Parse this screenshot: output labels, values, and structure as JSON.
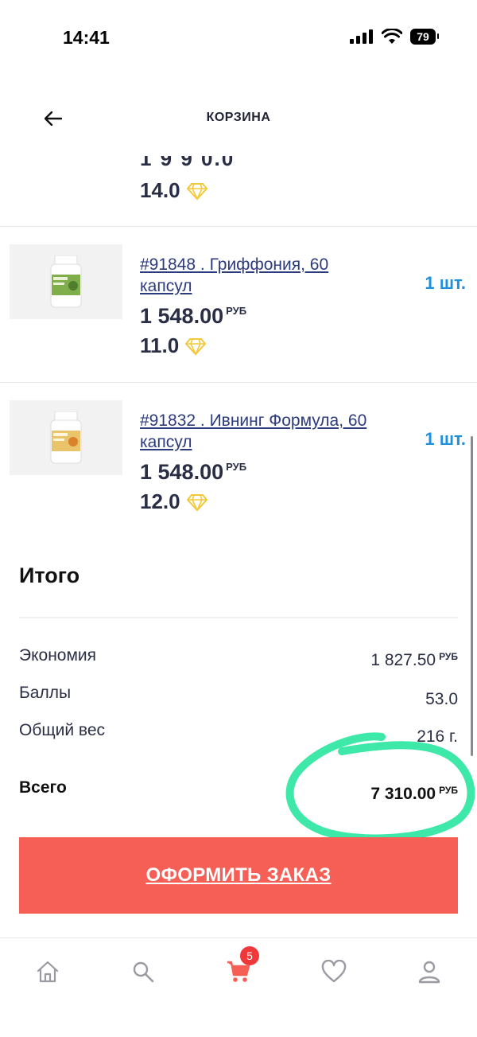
{
  "status_bar": {
    "time": "14:41",
    "battery": "79"
  },
  "header": {
    "title": "КОРЗИНА"
  },
  "partial_item": {
    "points": "14.0"
  },
  "items": [
    {
      "link": "#91848 . Гриффония, 60 капсул",
      "price": "1 548.00",
      "currency": "РУБ",
      "points": "11.0",
      "qty": "1 шт."
    },
    {
      "link": "#91832 . Ивнинг Формула, 60 капсул",
      "price": "1 548.00",
      "currency": "РУБ",
      "points": "12.0",
      "qty": "1 шт."
    }
  ],
  "summary": {
    "title": "Итого",
    "savings_label": "Экономия",
    "savings_value": "1 827.50",
    "savings_currency": "РУБ",
    "points_label": "Баллы",
    "points_value": "53.0",
    "weight_label": "Общий вес",
    "weight_value": "216 г.",
    "total_label": "Всего",
    "total_value": "7 310.00",
    "total_currency": "РУБ"
  },
  "order_button": {
    "label": "ОФОРМИТЬ ЗАКАЗ"
  },
  "tabbar": {
    "cart_count": "5"
  },
  "colors": {
    "accent": "#f65f55",
    "qty_blue": "#1e90e0",
    "badge": "#f0383b",
    "highlight": "#3de8a8",
    "diamond": "#f5d24a"
  }
}
